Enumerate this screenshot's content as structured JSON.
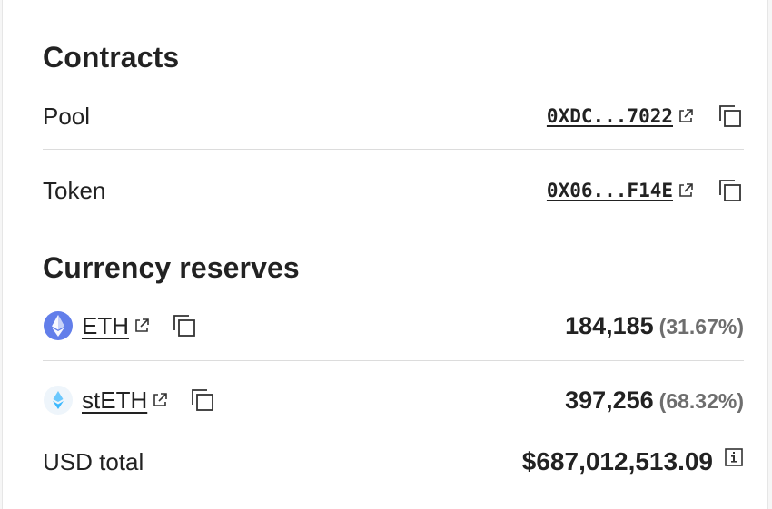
{
  "contracts": {
    "title": "Contracts",
    "pool": {
      "label": "Pool",
      "address": "0XDC...7022",
      "external_icon": "external-link-icon",
      "copy_icon": "copy-icon"
    },
    "token": {
      "label": "Token",
      "address": "0X06...F14E",
      "external_icon": "external-link-icon",
      "copy_icon": "copy-icon"
    }
  },
  "reserves": {
    "title": "Currency reserves",
    "items": [
      {
        "symbol": "ETH",
        "amount": "184,185",
        "percent": "(31.67%)",
        "icon": "eth-icon",
        "icon_color": "#627eea"
      },
      {
        "symbol": "stETH",
        "amount": "397,256",
        "percent": "(68.32%)",
        "icon": "steth-icon",
        "icon_color": "#00a3ff"
      }
    ],
    "usd_total": {
      "label": "USD total",
      "value": "$687,012,513.09",
      "info_icon": "info-icon"
    }
  }
}
